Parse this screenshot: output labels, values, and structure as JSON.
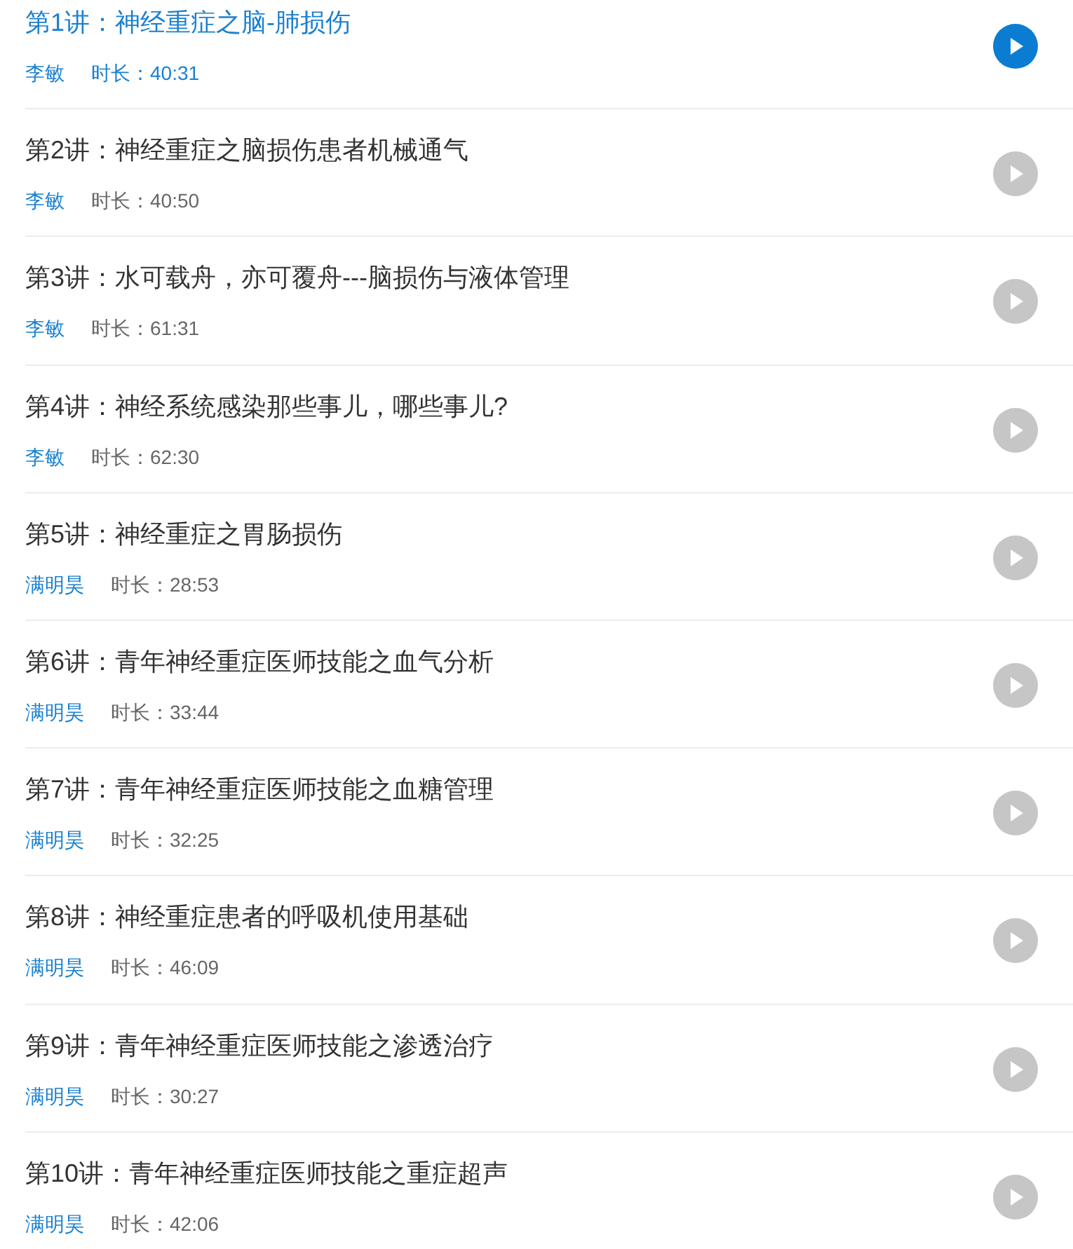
{
  "lectures": [
    {
      "title": "第1讲：神经重症之脑-肺损伤",
      "author": "李敏",
      "duration": "时长：40:31",
      "selected": true
    },
    {
      "title": "第2讲：神经重症之脑损伤患者机械通气",
      "author": "李敏",
      "duration": "时长：40:50",
      "selected": false
    },
    {
      "title": "第3讲：水可载舟，亦可覆舟---脑损伤与液体管理",
      "author": "李敏",
      "duration": "时长：61:31",
      "selected": false
    },
    {
      "title": "第4讲：神经系统感染那些事儿，哪些事儿?",
      "author": "李敏",
      "duration": "时长：62:30",
      "selected": false
    },
    {
      "title": "第5讲：神经重症之胃肠损伤",
      "author": "满明昊",
      "duration": "时长：28:53",
      "selected": false
    },
    {
      "title": "第6讲：青年神经重症医师技能之血气分析",
      "author": "满明昊",
      "duration": "时长：33:44",
      "selected": false
    },
    {
      "title": "第7讲：青年神经重症医师技能之血糖管理",
      "author": "满明昊",
      "duration": "时长：32:25",
      "selected": false
    },
    {
      "title": "第8讲：神经重症患者的呼吸机使用基础",
      "author": "满明昊",
      "duration": "时长：46:09",
      "selected": false
    },
    {
      "title": "第9讲：青年神经重症医师技能之渗透治疗",
      "author": "满明昊",
      "duration": "时长：30:27",
      "selected": false
    },
    {
      "title": "第10讲：青年神经重症医师技能之重症超声",
      "author": "满明昊",
      "duration": "时长：42:06",
      "selected": false
    }
  ]
}
